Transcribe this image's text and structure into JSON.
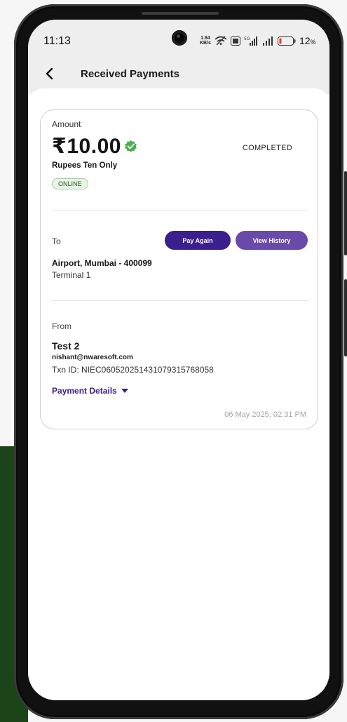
{
  "status_bar": {
    "time": "11:13",
    "speed_value": "1.84",
    "speed_unit": "KB/s",
    "battery_percent": "12"
  },
  "app_bar": {
    "title": "Received Payments",
    "back_icon": "chevron-left-icon"
  },
  "transaction": {
    "amount_label": "Amount",
    "amount_value": "₹10.00",
    "verified_icon": "verified-badge-icon",
    "status": "COMPLETED",
    "amount_in_words": "Rupees Ten Only",
    "mode_badge": "ONLINE",
    "to_label": "To",
    "pay_again_label": "Pay Again",
    "view_history_label": "View History",
    "to_name": "Airport, Mumbai - 400099",
    "to_sub": "Terminal 1",
    "from_label": "From",
    "from_name": "Test 2",
    "from_email": "nishant@nwaresoft.com",
    "txn_id": "Txn ID: NIEC06052025143107931576805​8",
    "payment_details_label": "Payment Details",
    "datetime": "06 May 2025, 02:31 PM"
  },
  "colors": {
    "primary": "#3b1f8c",
    "secondary": "#6a4aa8",
    "success": "#4caf50",
    "background_left": "#1b4519"
  }
}
